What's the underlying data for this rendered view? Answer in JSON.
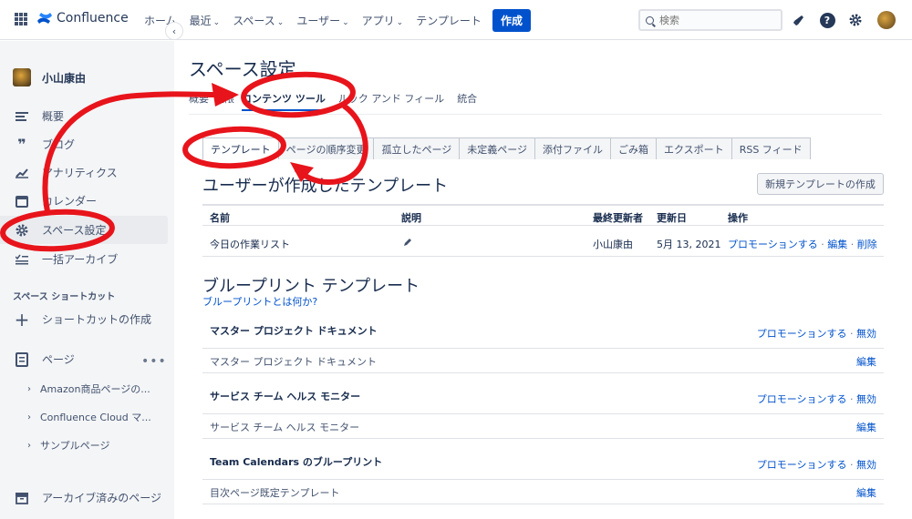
{
  "topnav": {
    "logo": "Confluence",
    "items": [
      {
        "label": "ホーム",
        "chevron": false
      },
      {
        "label": "最近",
        "chevron": true
      },
      {
        "label": "スペース",
        "chevron": true
      },
      {
        "label": "ユーザー",
        "chevron": true
      },
      {
        "label": "アプリ",
        "chevron": true
      },
      {
        "label": "テンプレート",
        "chevron": false
      }
    ],
    "create_label": "作成",
    "search_placeholder": "検索",
    "help_glyph": "?"
  },
  "sidebar": {
    "space_name": "小山康由",
    "items": [
      {
        "label": "概要",
        "icon": "menu-lines-icon"
      },
      {
        "label": "ブログ",
        "icon": "quote-icon"
      },
      {
        "label": "アナリティクス",
        "icon": "chart-line-icon"
      },
      {
        "label": "カレンダー",
        "icon": "calendar-icon"
      },
      {
        "label": "スペース設定",
        "icon": "gear-icon"
      },
      {
        "label": "一括アーカイブ",
        "icon": "archive-list-icon"
      }
    ],
    "shortcut_section": "スペース ショートカット",
    "create_shortcut": "ショートカットの作成",
    "pages_label": "ページ",
    "pages": [
      "Amazon商品ページの...",
      "Confluence Cloud マ...",
      "サンプルページ"
    ],
    "archived_label": "アーカイブ済みのページ"
  },
  "main": {
    "title": "スペース設定",
    "tabs": [
      "概要",
      "権限",
      "コンテンツ ツール",
      "ルック アンド フィール",
      "統合"
    ],
    "subtabs": [
      "テンプレート",
      "ページの順序変更",
      "孤立したページ",
      "未定義ページ",
      "添付ファイル",
      "ごみ箱",
      "エクスポート",
      "RSS フィード"
    ],
    "user_templates_heading": "ユーザーが作成したテンプレート",
    "new_template_button": "新規テンプレートの作成",
    "table_headers": [
      "名前",
      "説明",
      "最終更新者",
      "更新日",
      "操作"
    ],
    "rows": [
      {
        "name": "今日の作業リスト",
        "updated_by": "小山康由",
        "date": "5月 13, 2021",
        "promote": "プロモーションする",
        "edit": "編集",
        "delete": "削除"
      }
    ],
    "blueprint_heading": "ブループリント テンプレート",
    "blueprint_link": "ブループリントとは何か?",
    "blueprints": [
      {
        "title": "マスター プロジェクト ドキュメント",
        "sub": "マスター プロジェクト ドキュメント",
        "promote": "プロモーションする",
        "disable": "無効",
        "edit": "編集"
      },
      {
        "title": "サービス チーム ヘルス モニター",
        "sub": "サービス チーム ヘルス モニター",
        "promote": "プロモーションする",
        "disable": "無効",
        "edit": "編集"
      },
      {
        "title": "Team Calendars のブループリント",
        "sub": "目次ページ既定テンプレート",
        "promote": "プロモーションする",
        "disable": "無効",
        "edit": "編集"
      }
    ]
  },
  "colors": {
    "accent": "#0052cc",
    "annotation": "#e8141b"
  }
}
